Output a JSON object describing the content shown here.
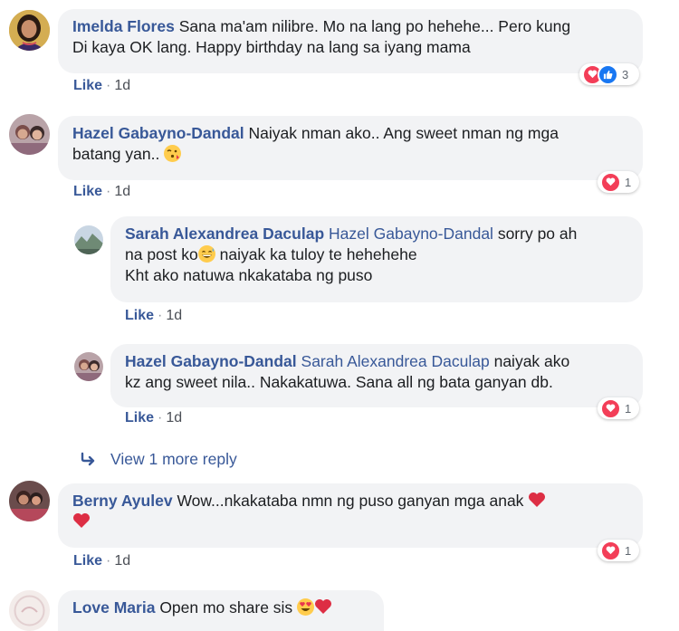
{
  "comments": [
    {
      "author": "Imelda Flores",
      "text_l1": "Sana ma'am nilibre. Mo na lang po hehehe... Pero kung",
      "text_l2": "Di kaya OK lang. Happy birthday na lang sa iyang mama",
      "like": "Like",
      "time": "1d",
      "reaction_count": "3",
      "avatar_color": "#c59a4a"
    },
    {
      "author": "Hazel Gabayno-Dandal",
      "text_l1": "Naiyak nman ako.. Ang sweet nman ng mga",
      "text_l2": "batang yan..",
      "like": "Like",
      "time": "1d",
      "reaction_count": "1",
      "emoji": "kissing-face"
    },
    {
      "author": "Berny Ayulev",
      "text_l1": "Wow...nkakataba nmn ng puso ganyan mga anak",
      "like": "Like",
      "time": "1d",
      "reaction_count": "1"
    },
    {
      "author": "Love Maria",
      "text_l1": "Open mo share sis"
    }
  ],
  "replies": [
    {
      "author": "Sarah Alexandrea Daculap",
      "mention": "Hazel Gabayno-Dandal",
      "text_l1": "sorry po ah",
      "text_l2a": "na post ko",
      "text_l2b": "naiyak ka tuloy te hehehehe",
      "text_l3": "Kht ako natuwa nkakataba ng puso",
      "like": "Like",
      "time": "1d"
    },
    {
      "author": "Hazel Gabayno-Dandal",
      "mention": "Sarah Alexandrea Daculap",
      "text_l1": "naiyak ako",
      "text_l2": "kz ang sweet nila.. Nakakatuwa. Sana all ng bata ganyan db.",
      "like": "Like",
      "time": "1d",
      "reaction_count": "1"
    }
  ],
  "view_more": "View 1 more reply",
  "colors": {
    "link": "#385898",
    "bubble": "#f2f3f5",
    "love": "#f33e58",
    "like": "#1877f2"
  }
}
